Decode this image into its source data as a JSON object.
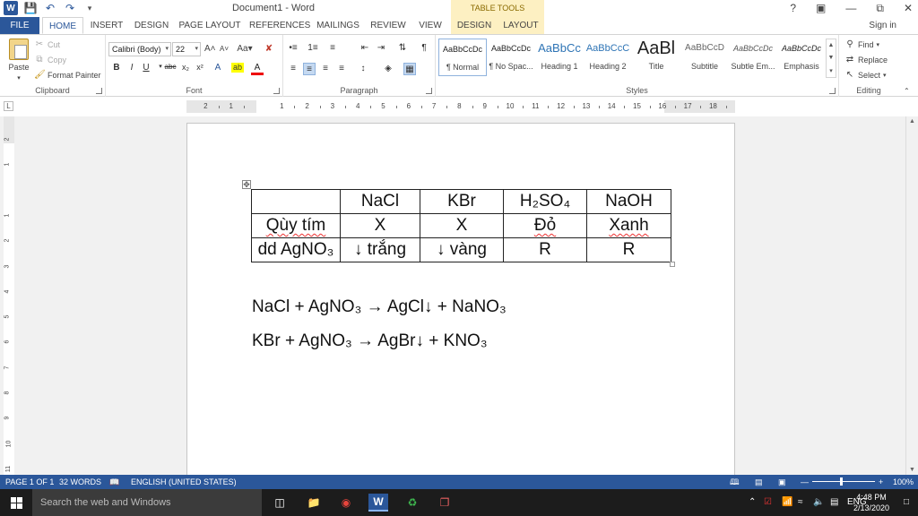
{
  "app": {
    "title": "Document1 - Word",
    "context_tab_group": "TABLE TOOLS",
    "help": "?",
    "sign_in": "Sign in"
  },
  "tabs": [
    {
      "label": "FILE"
    },
    {
      "label": "HOME"
    },
    {
      "label": "INSERT"
    },
    {
      "label": "DESIGN"
    },
    {
      "label": "PAGE LAYOUT"
    },
    {
      "label": "REFERENCES"
    },
    {
      "label": "MAILINGS"
    },
    {
      "label": "REVIEW"
    },
    {
      "label": "VIEW"
    },
    {
      "label": "DESIGN"
    },
    {
      "label": "LAYOUT"
    }
  ],
  "ribbon": {
    "clipboard": {
      "paste": "Paste",
      "cut": "Cut",
      "copy": "Copy",
      "format_painter": "Format Painter",
      "label": "Clipboard"
    },
    "font": {
      "font_name": "Calibri (Body)",
      "font_size": "22",
      "label": "Font"
    },
    "paragraph": {
      "label": "Paragraph"
    },
    "styles": {
      "label": "Styles",
      "items": [
        {
          "preview": "AaBbCcDc",
          "name": "¶ Normal"
        },
        {
          "preview": "AaBbCcDc",
          "name": "¶ No Spac..."
        },
        {
          "preview": "AaBbCc",
          "name": "Heading 1"
        },
        {
          "preview": "AaBbCcC",
          "name": "Heading 2"
        },
        {
          "preview": "AaBl",
          "name": "Title"
        },
        {
          "preview": "AaBbCcD",
          "name": "Subtitle"
        },
        {
          "preview": "AaBbCcDc",
          "name": "Subtle Em..."
        },
        {
          "preview": "AaBbCcDc",
          "name": "Emphasis"
        }
      ]
    },
    "editing": {
      "find": "Find",
      "replace": "Replace",
      "select": "Select",
      "label": "Editing"
    }
  },
  "ruler": {
    "numbers": [
      "2",
      "1",
      "1",
      "2",
      "3",
      "4",
      "5",
      "6",
      "7",
      "8",
      "9",
      "10",
      "11",
      "12",
      "13",
      "14",
      "15",
      "16",
      "17",
      "18"
    ],
    "vertical_numbers": [
      "2",
      "1",
      "1",
      "2",
      "3",
      "4",
      "5",
      "6",
      "7",
      "8",
      "9",
      "10",
      "11"
    ]
  },
  "document": {
    "table": {
      "header": [
        "",
        "NaCl",
        "KBr",
        "H₂SO₄",
        "NaOH"
      ],
      "rows": [
        [
          "Qùy tím",
          "X",
          "X",
          "Đỏ",
          "Xanh"
        ],
        [
          "dd AgNO₃",
          "↓ trắng",
          "↓ vàng",
          "R",
          "R"
        ]
      ]
    },
    "equations": [
      "NaCl + AgNO₃ → AgCl↓ + NaNO₃",
      "KBr + AgNO₃ → AgBr↓ + KNO₃"
    ]
  },
  "status": {
    "page": "PAGE 1 OF 1",
    "words": "32 WORDS",
    "language": "ENGLISH (UNITED STATES)",
    "zoom": "100%"
  },
  "taskbar": {
    "search_placeholder": "Search the web and Windows",
    "language": "ENG",
    "time": "4:48 PM",
    "date": "2/13/2020"
  },
  "colors": {
    "accent": "#2b579a",
    "table_tools": "#fdf0c2",
    "taskbar": "#1c1c1c"
  }
}
